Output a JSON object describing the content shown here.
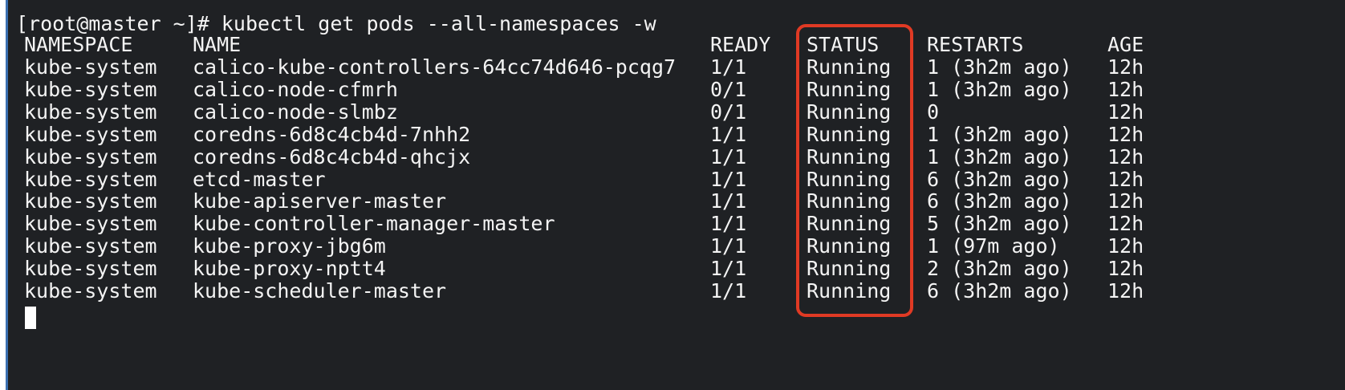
{
  "terminal": {
    "command_line": "[root@master ~]# kubectl get pods --all-namespaces -w",
    "headers": {
      "namespace": "NAMESPACE",
      "name": "NAME",
      "ready": "READY",
      "status": "STATUS",
      "restarts": "RESTARTS",
      "age": "AGE"
    },
    "rows": [
      {
        "namespace": "kube-system",
        "name": "calico-kube-controllers-64cc74d646-pcqg7",
        "ready": "1/1",
        "status": "Running",
        "restarts": "1 (3h2m ago)",
        "age": "12h"
      },
      {
        "namespace": "kube-system",
        "name": "calico-node-cfmrh",
        "ready": "0/1",
        "status": "Running",
        "restarts": "1 (3h2m ago)",
        "age": "12h"
      },
      {
        "namespace": "kube-system",
        "name": "calico-node-slmbz",
        "ready": "0/1",
        "status": "Running",
        "restarts": "0",
        "age": "12h"
      },
      {
        "namespace": "kube-system",
        "name": "coredns-6d8c4cb4d-7nhh2",
        "ready": "1/1",
        "status": "Running",
        "restarts": "1 (3h2m ago)",
        "age": "12h"
      },
      {
        "namespace": "kube-system",
        "name": "coredns-6d8c4cb4d-qhcjx",
        "ready": "1/1",
        "status": "Running",
        "restarts": "1 (3h2m ago)",
        "age": "12h"
      },
      {
        "namespace": "kube-system",
        "name": "etcd-master",
        "ready": "1/1",
        "status": "Running",
        "restarts": "6 (3h2m ago)",
        "age": "12h"
      },
      {
        "namespace": "kube-system",
        "name": "kube-apiserver-master",
        "ready": "1/1",
        "status": "Running",
        "restarts": "6 (3h2m ago)",
        "age": "12h"
      },
      {
        "namespace": "kube-system",
        "name": "kube-controller-manager-master",
        "ready": "1/1",
        "status": "Running",
        "restarts": "5 (3h2m ago)",
        "age": "12h"
      },
      {
        "namespace": "kube-system",
        "name": "kube-proxy-jbg6m",
        "ready": "1/1",
        "status": "Running",
        "restarts": "1 (97m ago)",
        "age": "12h"
      },
      {
        "namespace": "kube-system",
        "name": "kube-proxy-nptt4",
        "ready": "1/1",
        "status": "Running",
        "restarts": "2 (3h2m ago)",
        "age": "12h"
      },
      {
        "namespace": "kube-system",
        "name": "kube-scheduler-master",
        "ready": "1/1",
        "status": "Running",
        "restarts": "6 (3h2m ago)",
        "age": "12h"
      }
    ]
  },
  "colors": {
    "background": "#1f2124",
    "text": "#f4f4f4",
    "highlight_box": "#e03a24",
    "cursor": "#ffffff"
  }
}
